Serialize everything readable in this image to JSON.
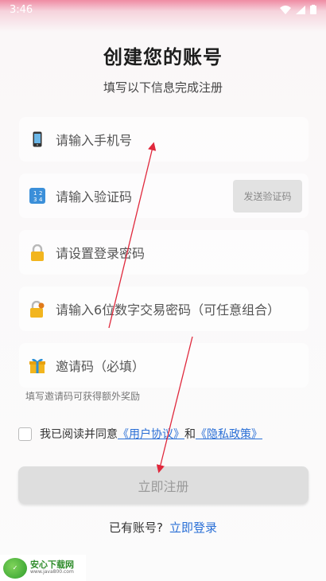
{
  "status_bar": {
    "time": "3:46"
  },
  "header": {
    "title": "创建您的账号",
    "subtitle": "填写以下信息完成注册"
  },
  "fields": [
    {
      "name": "phone",
      "icon": "mobile-phone-icon",
      "placeholder": "请输入手机号"
    },
    {
      "name": "verify-code",
      "icon": "keypad-icon",
      "placeholder": "请输入验证码",
      "action": "发送验证码"
    },
    {
      "name": "login-password",
      "icon": "lock-icon",
      "placeholder": "请设置登录密码"
    },
    {
      "name": "trade-password",
      "icon": "lock-with-key-icon",
      "placeholder": "请输入6位数字交易密码（可任意组合）"
    },
    {
      "name": "invite-code",
      "icon": "gift-icon",
      "placeholder": "邀请码（必填）"
    }
  ],
  "invite_hint": "填写邀请码可获得额外奖励",
  "agreement": {
    "prefix": "我已阅读并同意",
    "user_agreement": "《用户协议》",
    "and": "和",
    "privacy_policy": "《隐私政策》"
  },
  "register_button": "立即注册",
  "login": {
    "prompt": "已有账号?",
    "link": "立即登录"
  },
  "watermark": {
    "title": "安心下载网",
    "url": "www.java800.com"
  },
  "colors": {
    "link": "#2a6fd6",
    "annotation_arrow": "#e0283c",
    "button_bg": "#dedede"
  }
}
